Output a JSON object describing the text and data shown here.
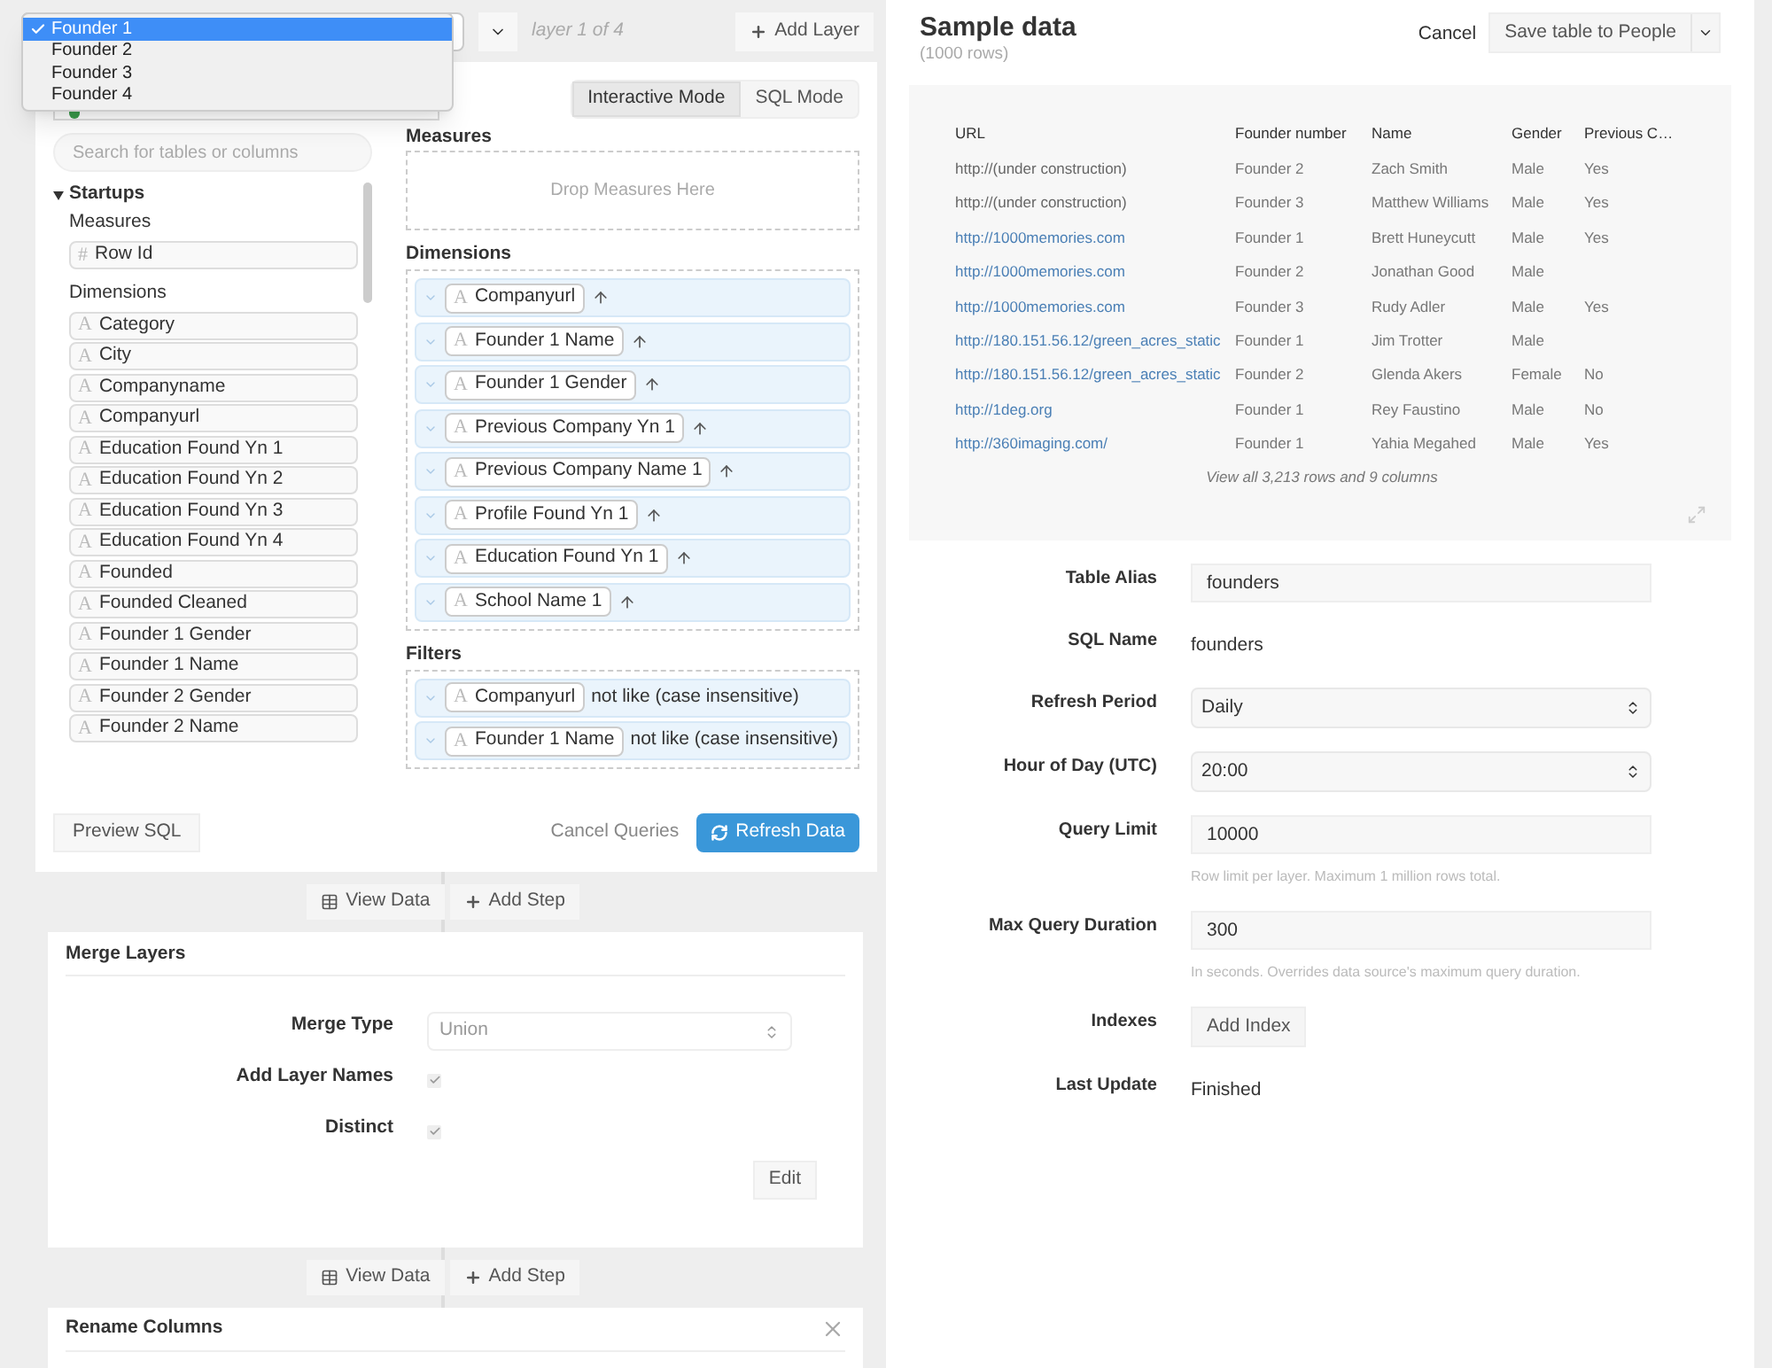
{
  "layer_picker": {
    "options": [
      {
        "label": "Founder 1",
        "selected": true
      },
      {
        "label": "Founder 2",
        "selected": false
      },
      {
        "label": "Founder 3",
        "selected": false
      },
      {
        "label": "Founder 4",
        "selected": false
      }
    ],
    "position_label": "layer 1 of 4",
    "add_button": "Add Layer"
  },
  "query_builder": {
    "modes": [
      {
        "label": "Interactive Mode",
        "selected": true
      },
      {
        "label": "SQL Mode",
        "selected": false
      }
    ],
    "search": {
      "placeholder": "Search for tables or columns"
    },
    "tree": {
      "label": "Startups",
      "expanded": true,
      "sections": [
        {
          "title": "Measures",
          "fields": [
            {
              "label": "Row Id",
              "glyph": "#"
            }
          ]
        },
        {
          "title": "Dimensions",
          "fields": [
            {
              "label": "Category",
              "glyph": "A"
            },
            {
              "label": "City",
              "glyph": "A"
            },
            {
              "label": "Companyname",
              "glyph": "A"
            },
            {
              "label": "Companyurl",
              "glyph": "A"
            },
            {
              "label": "Education Found Yn 1",
              "glyph": "A"
            },
            {
              "label": "Education Found Yn 2",
              "glyph": "A"
            },
            {
              "label": "Education Found Yn 3",
              "glyph": "A"
            },
            {
              "label": "Education Found Yn 4",
              "glyph": "A"
            },
            {
              "label": "Founded",
              "glyph": "A"
            },
            {
              "label": "Founded Cleaned",
              "glyph": "A"
            },
            {
              "label": "Founder 1 Gender",
              "glyph": "A"
            },
            {
              "label": "Founder 1 Name",
              "glyph": "A"
            },
            {
              "label": "Founder 2 Gender",
              "glyph": "A"
            },
            {
              "label": "Founder 2 Name",
              "glyph": "A"
            }
          ]
        }
      ]
    },
    "measures": {
      "title": "Measures",
      "placeholder": "Drop Measures Here"
    },
    "dimensions": {
      "title": "Dimensions",
      "items": [
        {
          "label": "Companyurl",
          "glyph": "A"
        },
        {
          "label": "Founder 1 Name",
          "glyph": "A"
        },
        {
          "label": "Founder 1 Gender",
          "glyph": "A"
        },
        {
          "label": "Previous Company Yn 1",
          "glyph": "A"
        },
        {
          "label": "Previous Company Name 1",
          "glyph": "A"
        },
        {
          "label": "Profile Found Yn 1",
          "glyph": "A"
        },
        {
          "label": "Education Found Yn 1",
          "glyph": "A"
        },
        {
          "label": "School Name 1",
          "glyph": "A"
        }
      ]
    },
    "filters": {
      "title": "Filters",
      "items": [
        {
          "label": "Companyurl",
          "glyph": "A",
          "operator": "not like (case insensitive)"
        },
        {
          "label": "Founder 1 Name",
          "glyph": "A",
          "operator": "not like (case insensitive)"
        }
      ]
    },
    "preview_button": "Preview SQL",
    "cancel_button": "Cancel Queries",
    "refresh_button": "Refresh Data"
  },
  "step_actions_1": {
    "view": "View Data",
    "add": "Add Step"
  },
  "merge_step": {
    "title": "Merge Layers",
    "merge_type": {
      "label": "Merge Type",
      "value": "Union",
      "disabled": true
    },
    "options": [
      {
        "label": "Add Layer Names",
        "checked": true
      },
      {
        "label": "Distinct",
        "checked": true
      }
    ],
    "edit_button": "Edit"
  },
  "step_actions_2": {
    "view": "View Data",
    "add": "Add Step"
  },
  "rename_step": {
    "title": "Rename Columns"
  },
  "sample": {
    "title": "Sample data",
    "subtitle": "(1000 rows)",
    "cancel": "Cancel",
    "save_button": "Save table to People",
    "columns": [
      "URL",
      "Founder number",
      "Name",
      "Gender",
      "Previous C…"
    ],
    "rows": [
      {
        "link": false,
        "cells": [
          "http://(under construction)",
          "Founder 2",
          "Zach Smith",
          "Male",
          "Yes"
        ]
      },
      {
        "link": false,
        "cells": [
          "http://(under construction)",
          "Founder 3",
          "Matthew Williams",
          "Male",
          "Yes"
        ]
      },
      {
        "link": true,
        "cells": [
          "http://1000memories.com",
          "Founder 1",
          "Brett Huneycutt",
          "Male",
          "Yes"
        ]
      },
      {
        "link": true,
        "cells": [
          "http://1000memories.com",
          "Founder 2",
          "Jonathan Good",
          "Male",
          ""
        ]
      },
      {
        "link": true,
        "cells": [
          "http://1000memories.com",
          "Founder 3",
          "Rudy Adler",
          "Male",
          "Yes"
        ]
      },
      {
        "link": true,
        "cells": [
          "http://180.151.56.12/green_acres_static",
          "Founder 1",
          "Jim Trotter",
          "Male",
          ""
        ]
      },
      {
        "link": true,
        "cells": [
          "http://180.151.56.12/green_acres_static",
          "Founder 2",
          "Glenda Akers",
          "Female",
          "No"
        ]
      },
      {
        "link": true,
        "cells": [
          "http://1deg.org",
          "Founder 1",
          "Rey Faustino",
          "Male",
          "No"
        ]
      },
      {
        "link": true,
        "cells": [
          "http://360imaging.com/",
          "Founder 1",
          "Yahia Megahed",
          "Male",
          "Yes"
        ]
      }
    ],
    "footer": "View all 3,213 rows and 9 columns"
  },
  "settings": [
    {
      "kind": "input",
      "label": "Table Alias",
      "value": "founders"
    },
    {
      "kind": "text",
      "label": "SQL Name",
      "value": "founders"
    },
    {
      "kind": "select",
      "label": "Refresh Period",
      "value": "Daily"
    },
    {
      "kind": "select",
      "label": "Hour of Day (UTC)",
      "value": "20:00"
    },
    {
      "kind": "input",
      "label": "Query Limit",
      "value": "10000",
      "help": "Row limit per layer. Maximum 1 million rows total."
    },
    {
      "kind": "input",
      "label": "Max Query Duration",
      "value": "300",
      "help": "In seconds. Overrides data source's maximum query duration."
    },
    {
      "kind": "button",
      "label": "Indexes",
      "value": "Add Index"
    },
    {
      "kind": "text",
      "label": "Last Update",
      "value": "Finished"
    }
  ]
}
